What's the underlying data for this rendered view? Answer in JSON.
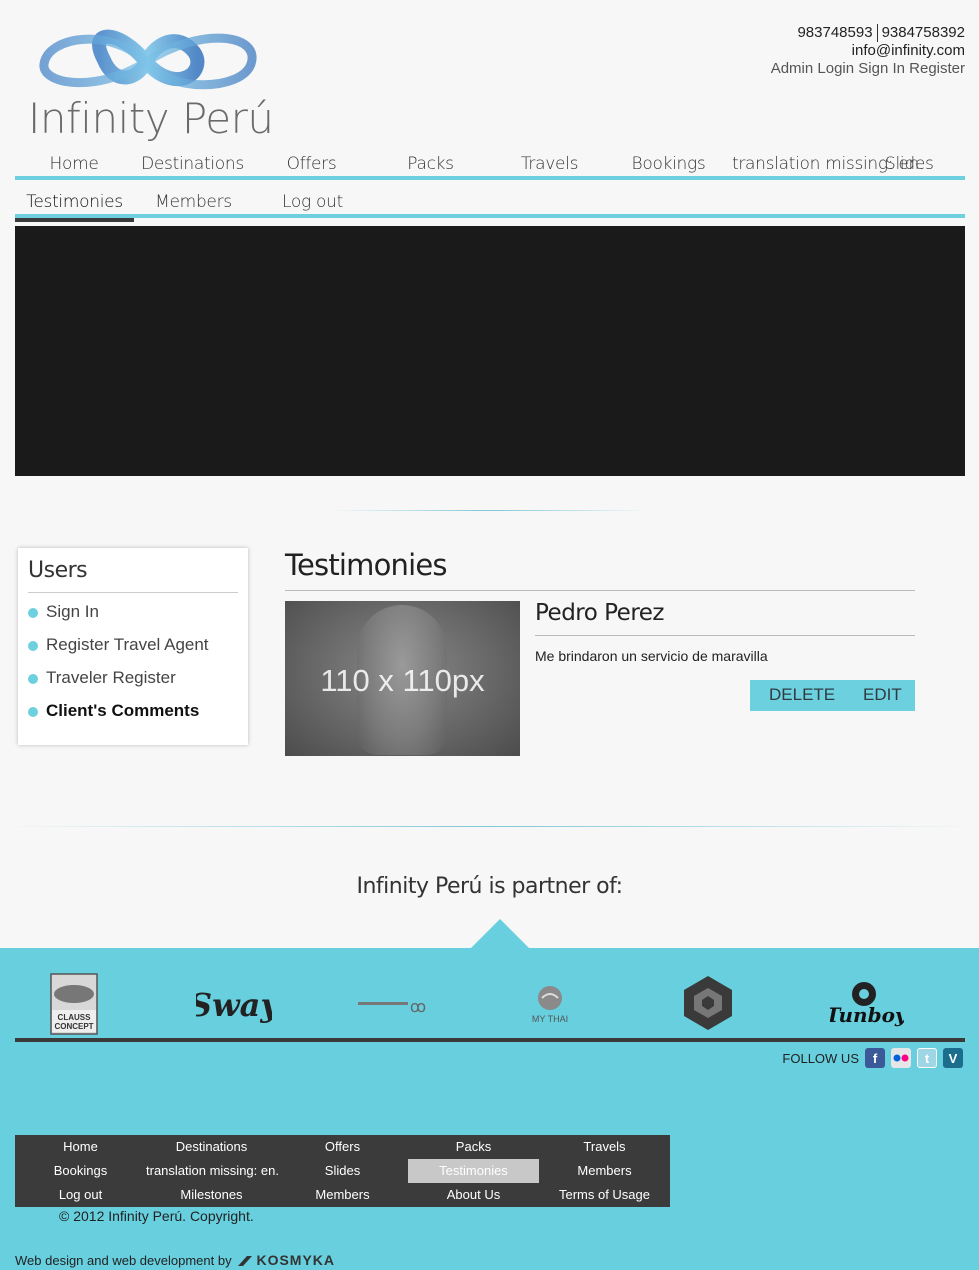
{
  "header": {
    "logo_text": "Infinity Perú",
    "phone1": "983748593",
    "phone2": "9384758392",
    "email": "info@infinity.com",
    "links": [
      "Admin Login",
      "Sign In",
      "Register"
    ]
  },
  "nav_primary": [
    "Home",
    "Destinations",
    "Offers",
    "Packs",
    "Travels",
    "Bookings",
    "translation missing: en.",
    "Slides"
  ],
  "nav_secondary": [
    "Testimonies",
    "Members",
    "Log out"
  ],
  "sidebar": {
    "title": "Users",
    "items": [
      "Sign In",
      "Register Travel Agent",
      "Traveler Register",
      "Client's Comments"
    ]
  },
  "main": {
    "title": "Testimonies",
    "testimony": {
      "image_label": "110 x 110px",
      "name": "Pedro Perez",
      "text": "Me brindaron un servicio de maravilla",
      "delete_label": "DELETE",
      "edit_label": "EDIT"
    }
  },
  "partners": {
    "heading": "Infinity Perú is partner of:",
    "logos": [
      "CLAUSS CONCEPT",
      "Sway",
      "",
      "MY THAI",
      "",
      "Tunboy"
    ]
  },
  "follow": {
    "label": "FOLLOW US",
    "icons": [
      "facebook-icon",
      "flickr-icon",
      "twitter-icon",
      "vimeo-icon"
    ]
  },
  "footer_nav": [
    "Home",
    "Destinations",
    "Offers",
    "Packs",
    "Travels",
    "Bookings",
    "translation missing: en.",
    "Slides",
    "Testimonies",
    "Members",
    "Log out",
    "Milestones",
    "Members",
    "About Us",
    "Terms of Usage"
  ],
  "copyright": "© 2012 Infinity Perú. Copyright.",
  "credit": {
    "text": "Web design and web development by",
    "brand": "KOSMYKA"
  },
  "colors": {
    "accent": "#6cd0df",
    "footer": "#67cfde",
    "dark": "#3b3b3b"
  }
}
